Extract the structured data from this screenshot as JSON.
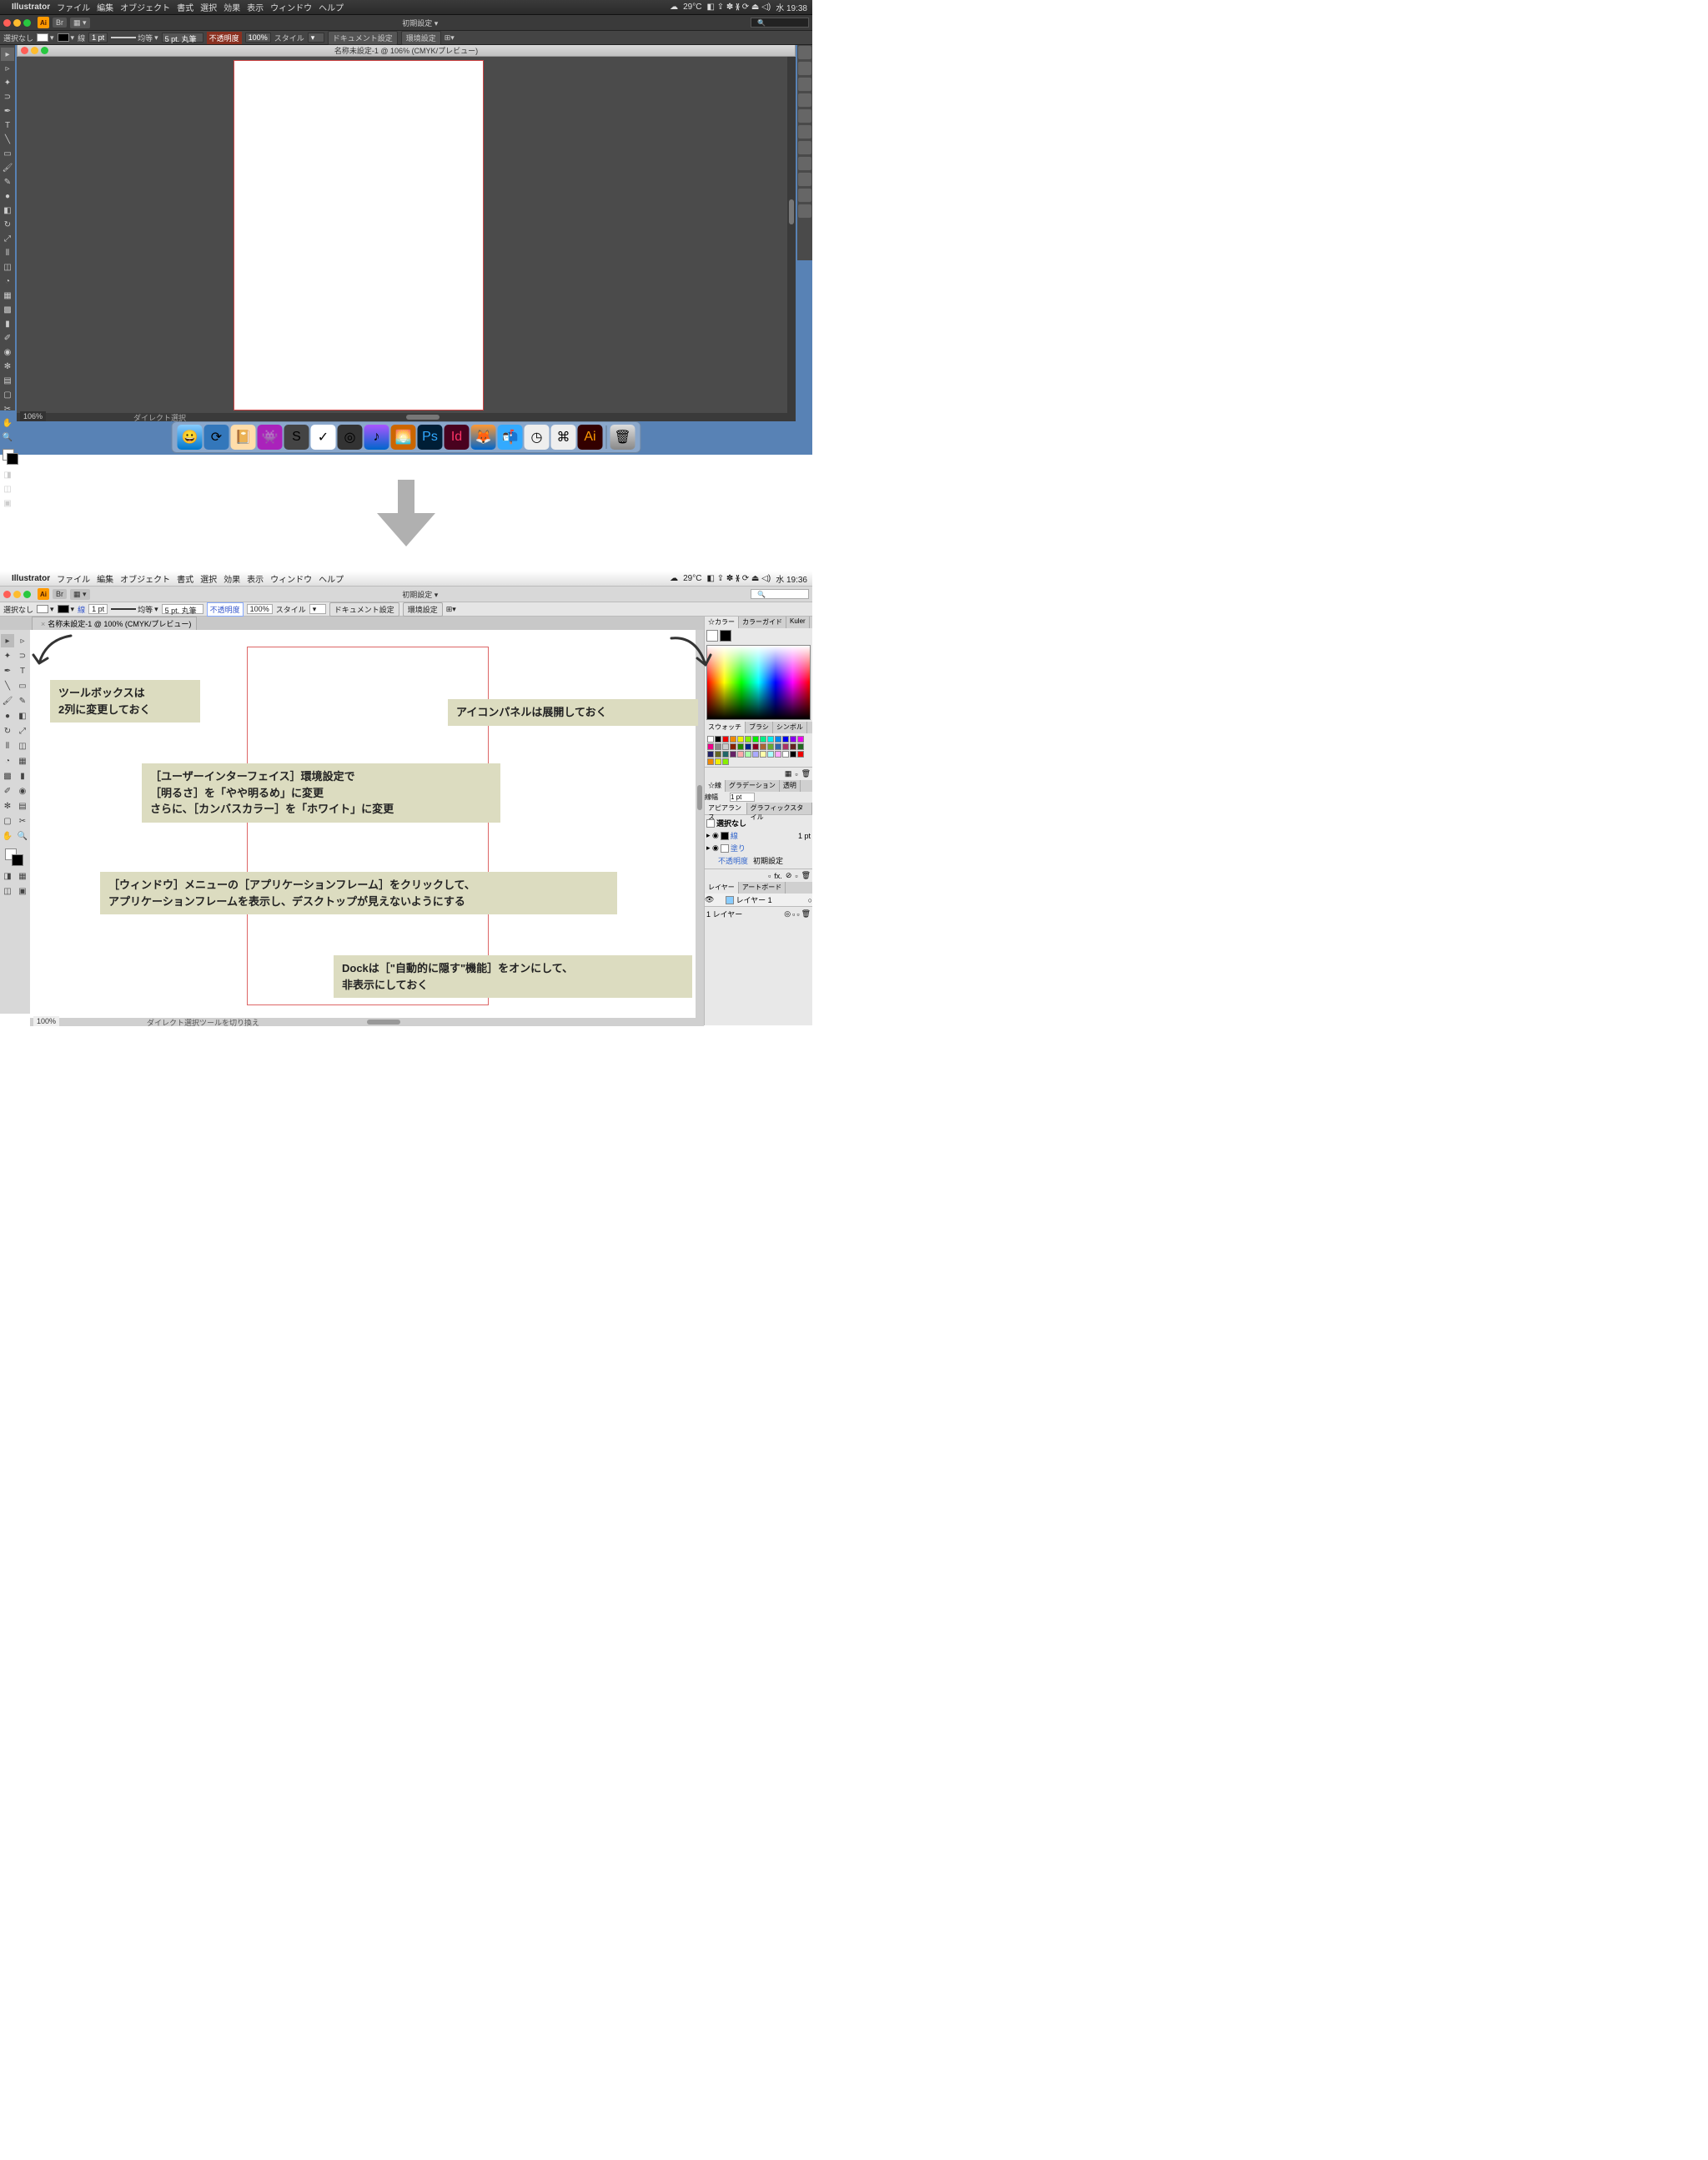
{
  "scene1": {
    "menubar": {
      "app_name": "Illustrator",
      "menus": [
        "ファイル",
        "編集",
        "オブジェクト",
        "書式",
        "選択",
        "効果",
        "表示",
        "ウィンドウ",
        "ヘルプ"
      ],
      "right": {
        "temp": "29°C",
        "clock": "水 19:38"
      }
    },
    "topbar": {
      "workspace": "初期設定"
    },
    "control": {
      "selection": "選択なし",
      "stroke_label": "線",
      "stroke_weight": "1 pt",
      "uniform": "均等",
      "basic": "5 pt. 丸筆",
      "opacity_label": "不透明度",
      "opacity_val": "100%",
      "style_label": "スタイル",
      "doc_setup": "ドキュメント設定",
      "prefs": "環境設定"
    },
    "doc_title": "名称未設定-1 @ 106% (CMYK/プレビュー)",
    "zoom": "106%",
    "status": "ダイレクト選択",
    "dock_placeholder": ""
  },
  "scene2": {
    "menubar": {
      "app_name": "Illustrator",
      "menus": [
        "ファイル",
        "編集",
        "オブジェクト",
        "書式",
        "選択",
        "効果",
        "表示",
        "ウィンドウ",
        "ヘルプ"
      ],
      "right": {
        "temp": "29°C",
        "clock": "水 19:36"
      }
    },
    "topbar": {
      "workspace": "初期設定"
    },
    "control": {
      "selection": "選択なし",
      "stroke_label": "線",
      "stroke_weight": "1 pt",
      "uniform": "均等",
      "basic": "5 pt. 丸筆",
      "opacity_label": "不透明度",
      "opacity_val": "100%",
      "style_label": "スタイル",
      "doc_setup": "ドキュメント設定",
      "prefs": "環境設定"
    },
    "doc_tab": "名称未設定-1 @ 100% (CMYK/プレビュー)",
    "zoom": "100%",
    "status": "ダイレクト選択ツールを切り換え",
    "rpanel": {
      "color_tabs": [
        "☆カラー",
        "カラーガイド",
        "Kuler"
      ],
      "swatch_tabs": [
        "スウォッチ",
        "ブラシ",
        "シンボル"
      ],
      "stroke_tabs": [
        "☆線",
        "グラデーション",
        "透明"
      ],
      "stroke_w_label": "線幅",
      "stroke_w": "1 pt",
      "appearance_tabs": [
        "アピアランス",
        "グラフィックスタイル"
      ],
      "appearance": {
        "nosel": "選択なし",
        "stroke": "線",
        "stroke_val": "1 pt",
        "fill": "塗り",
        "opacity": "不透明度",
        "default": "初期設定"
      },
      "layer_tabs": [
        "レイヤー",
        "アートボード"
      ],
      "layer_name": "レイヤー 1",
      "layer_count": "1 レイヤー"
    },
    "annotations": {
      "a1": "ツールボックスは\n2列に変更しておく",
      "a2": "アイコンパネルは展開しておく",
      "a3": "［ユーザーインターフェイス］環境設定で\n［明るさ］を「やや明るめ」に変更\nさらに、［カンバスカラー］を「ホワイト」に変更",
      "a4": "［ウィンドウ］メニューの［アプリケーションフレーム］をクリックして、\nアプリケーションフレームを表示し、デスクトップが見えないようにする",
      "a5": "Dockは［\"自動的に隠す\"機能］をオンにして、\n非表示にしておく"
    }
  },
  "ai_label": "Ai"
}
